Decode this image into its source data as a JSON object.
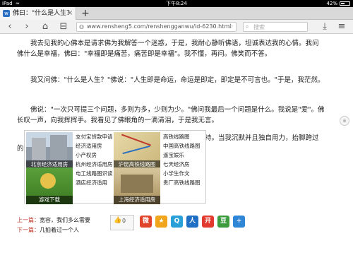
{
  "status": {
    "carrier": "iPad",
    "wifi": "≈",
    "time": "下午8:24",
    "battery": "42%"
  },
  "tab": {
    "favicon": "w",
    "title": "佛曰：\"什么是人生？",
    "close": "×"
  },
  "new_tab": "+",
  "toolbar": {
    "back": "‹",
    "forward": "›",
    "home": "⌂",
    "bookmarks": "⊟",
    "url": "www.rensheng5.com/renshengganwu/id-6230.html",
    "reload": "↻",
    "search_placeholder": "搜索",
    "download": "⤓",
    "menu": "≡"
  },
  "article": {
    "p1": "我去见我的心佛本是请求佛为我解答一个迷惑，于是，我耐心静听佛语，坦诚表达我的心情。我问佛什么是幸福，佛曰：\"幸福即是痛苦，痛苦即是幸福\"。我不懂，再问。佛笑而不答。",
    "p2": "我又问佛：\"什么是人生？\"佛说：\"人生即是命运，命运是即定，即定是不可言也。\"于是，我茫然。",
    "p3": "佛说：\"一次只可提三个问题，多则为多，少则为少。\"佛问我最后一个问题是什么。我说是\"爱\"。佛长叹一声，向我挥挥手。我看见了佛眼角的一滴清泪，于是我无言。",
    "p4": "我相信了宿命。亦承认是这浊世折墮了自己纯简的信仰和坚持。当我沉默并且独自用力，抬脚跨过的这道槛亦是了断偿清了命数中前世所亏欠的情债和恩怨。"
  },
  "ads": {
    "tiles": [
      {
        "caption": "北京经济适用房"
      },
      {
        "caption": "沪昆高铁线路图"
      },
      {
        "caption": "游戏下载"
      },
      {
        "caption": "上海经济适用房"
      }
    ],
    "links_col1": [
      "支付宝贷款申请",
      "经济适用房",
      "小产权房",
      "杭州经济适用房",
      "电工线路图识读",
      "酒店经济适用"
    ],
    "links_col2": [
      "高铁线路图",
      "中国高铁线路图",
      "遥宝娱乐",
      "七天经济房",
      "小学生作文",
      "贵厂高铁线路图"
    ]
  },
  "nav": {
    "prev_label": "上一篇：",
    "prev_title": "宽容，我们多么需要",
    "next_label": "下一篇：",
    "next_title": "几拍着过一个人"
  },
  "like": {
    "icon": "👍",
    "count": "0"
  },
  "share_buttons": [
    {
      "glyph": "微",
      "color": "#e0452b"
    },
    {
      "glyph": "★",
      "color": "#f1a51c"
    },
    {
      "glyph": "Q",
      "color": "#2aa0d8"
    },
    {
      "glyph": "人",
      "color": "#1f6fc4"
    },
    {
      "glyph": "开",
      "color": "#e23a2e"
    },
    {
      "glyph": "豆",
      "color": "#3d9c3f"
    },
    {
      "glyph": "+",
      "color": "#2f86d6"
    }
  ]
}
